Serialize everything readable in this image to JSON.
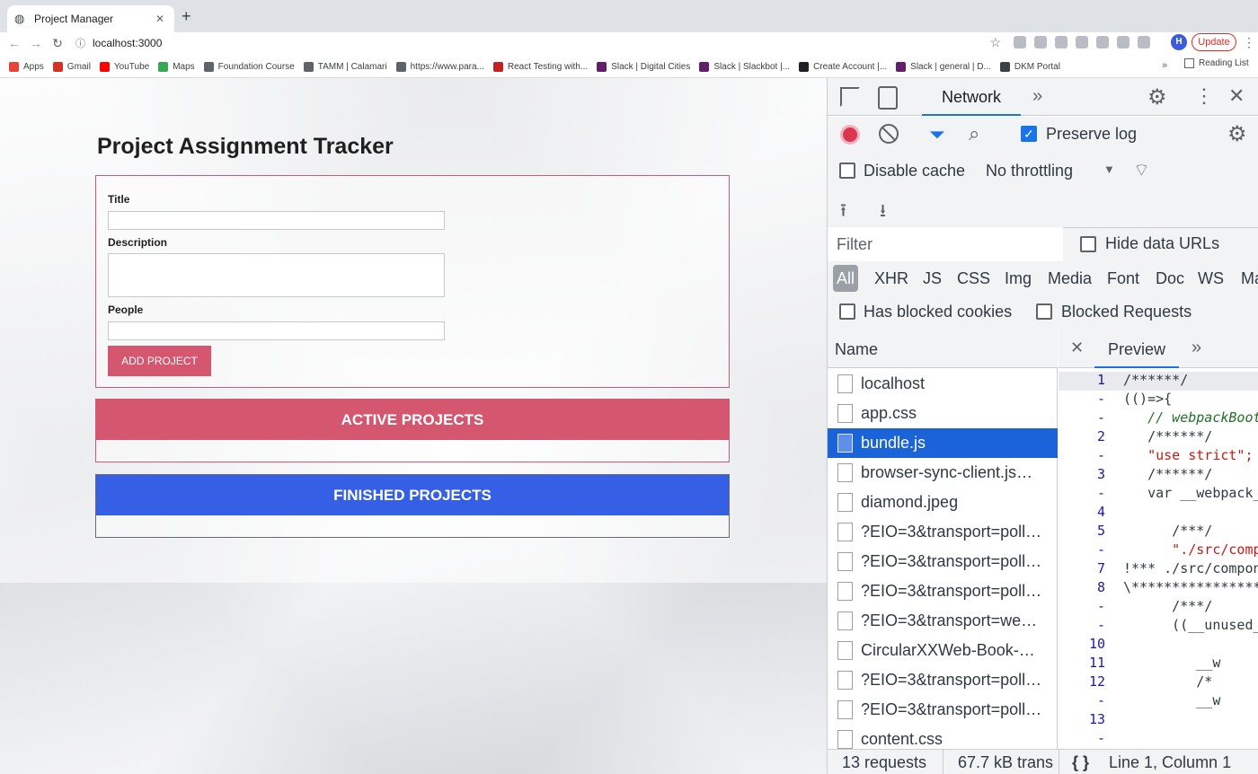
{
  "browser": {
    "tab_title": "Project Manager",
    "url": "localhost:3000",
    "update_label": "Update",
    "avatar_letter": "H",
    "bookmarks": [
      {
        "label": "Apps",
        "color": "#ea4335"
      },
      {
        "label": "Gmail",
        "color": "#d93025"
      },
      {
        "label": "YouTube",
        "color": "#ff0000"
      },
      {
        "label": "Maps",
        "color": "#34a853"
      },
      {
        "label": "Foundation Course",
        "color": "#5f6368"
      },
      {
        "label": "TAMM | Calamari",
        "color": "#5f6368"
      },
      {
        "label": "https://www.para...",
        "color": "#5f6368"
      },
      {
        "label": "React Testing with...",
        "color": "#c5221f"
      },
      {
        "label": "Slack | Digital Cities",
        "color": "#611f69"
      },
      {
        "label": "Slack | Slackbot |...",
        "color": "#611f69"
      },
      {
        "label": "Create Account |...",
        "color": "#202124"
      },
      {
        "label": "Slack | general | D...",
        "color": "#611f69"
      },
      {
        "label": "DKM Portal",
        "color": "#3c4043"
      }
    ],
    "bookmarks_more": "»",
    "reading_list": "Reading List"
  },
  "page": {
    "title": "Project Assignment Tracker",
    "form": {
      "title_label": "Title",
      "description_label": "Description",
      "people_label": "People",
      "submit_label": "ADD PROJECT"
    },
    "active_header": "ACTIVE PROJECTS",
    "finished_header": "FINISHED PROJECTS",
    "colors": {
      "active": "#d5566f",
      "finished": "#3560e6"
    }
  },
  "devtools": {
    "panel_tab": "Network",
    "preserve_log": "Preserve log",
    "disable_cache": "Disable cache",
    "throttling": "No throttling",
    "filter_placeholder": "Filter",
    "hide_data_urls": "Hide data URLs",
    "type_filters": [
      "All",
      "XHR",
      "JS",
      "CSS",
      "Img",
      "Media",
      "Font",
      "Doc",
      "WS",
      "Ma"
    ],
    "has_blocked_cookies": "Has blocked cookies",
    "blocked_requests": "Blocked Requests",
    "name_header": "Name",
    "requests": [
      "localhost",
      "app.css",
      "bundle.js",
      "browser-sync-client.js…",
      "diamond.jpeg",
      "?EIO=3&transport=poll…",
      "?EIO=3&transport=poll…",
      "?EIO=3&transport=poll…",
      "?EIO=3&transport=we…",
      "CircularXXWeb-Book-…",
      "?EIO=3&transport=poll…",
      "?EIO=3&transport=poll…",
      "content.css"
    ],
    "selected_request": "bundle.js",
    "preview_tab": "Preview",
    "code_lines": [
      {
        "ln": "1",
        "txt": "/******/",
        "cls": ""
      },
      {
        "ln": "-",
        "txt": "(()=>{",
        "cls": ""
      },
      {
        "ln": "-",
        "txt": "   // webpackBootstrap",
        "cls": "cm"
      },
      {
        "ln": "2",
        "txt": "   /******/",
        "cls": ""
      },
      {
        "ln": "-",
        "txt": "   \"use strict\";",
        "cls": "str"
      },
      {
        "ln": "3",
        "txt": "   /******/",
        "cls": ""
      },
      {
        "ln": "-",
        "txt": "   var __webpack_modules__",
        "cls": ""
      },
      {
        "ln": "4",
        "txt": "",
        "cls": ""
      },
      {
        "ln": "5",
        "txt": "      /***/",
        "cls": ""
      },
      {
        "ln": "-",
        "txt": "      \"./src/components",
        "cls": "str"
      },
      {
        "ln": "7",
        "txt": "!*** ./src/components",
        "cls": ""
      },
      {
        "ln": "8",
        "txt": "\\*******************",
        "cls": ""
      },
      {
        "ln": "-",
        "txt": "      /***/",
        "cls": ""
      },
      {
        "ln": "-",
        "txt": "      ((__unused_",
        "cls": ""
      },
      {
        "ln": "10",
        "txt": "",
        "cls": ""
      },
      {
        "ln": "11",
        "txt": "         __w",
        "cls": ""
      },
      {
        "ln": "12",
        "txt": "         /*",
        "cls": ""
      },
      {
        "ln": "-",
        "txt": "         __w",
        "cls": ""
      },
      {
        "ln": "13",
        "txt": "",
        "cls": ""
      },
      {
        "ln": "-",
        "txt": "",
        "cls": ""
      }
    ],
    "status_requests": "13 requests",
    "status_transferred": "67.7 kB trans",
    "status_position": "Line 1, Column 1"
  }
}
